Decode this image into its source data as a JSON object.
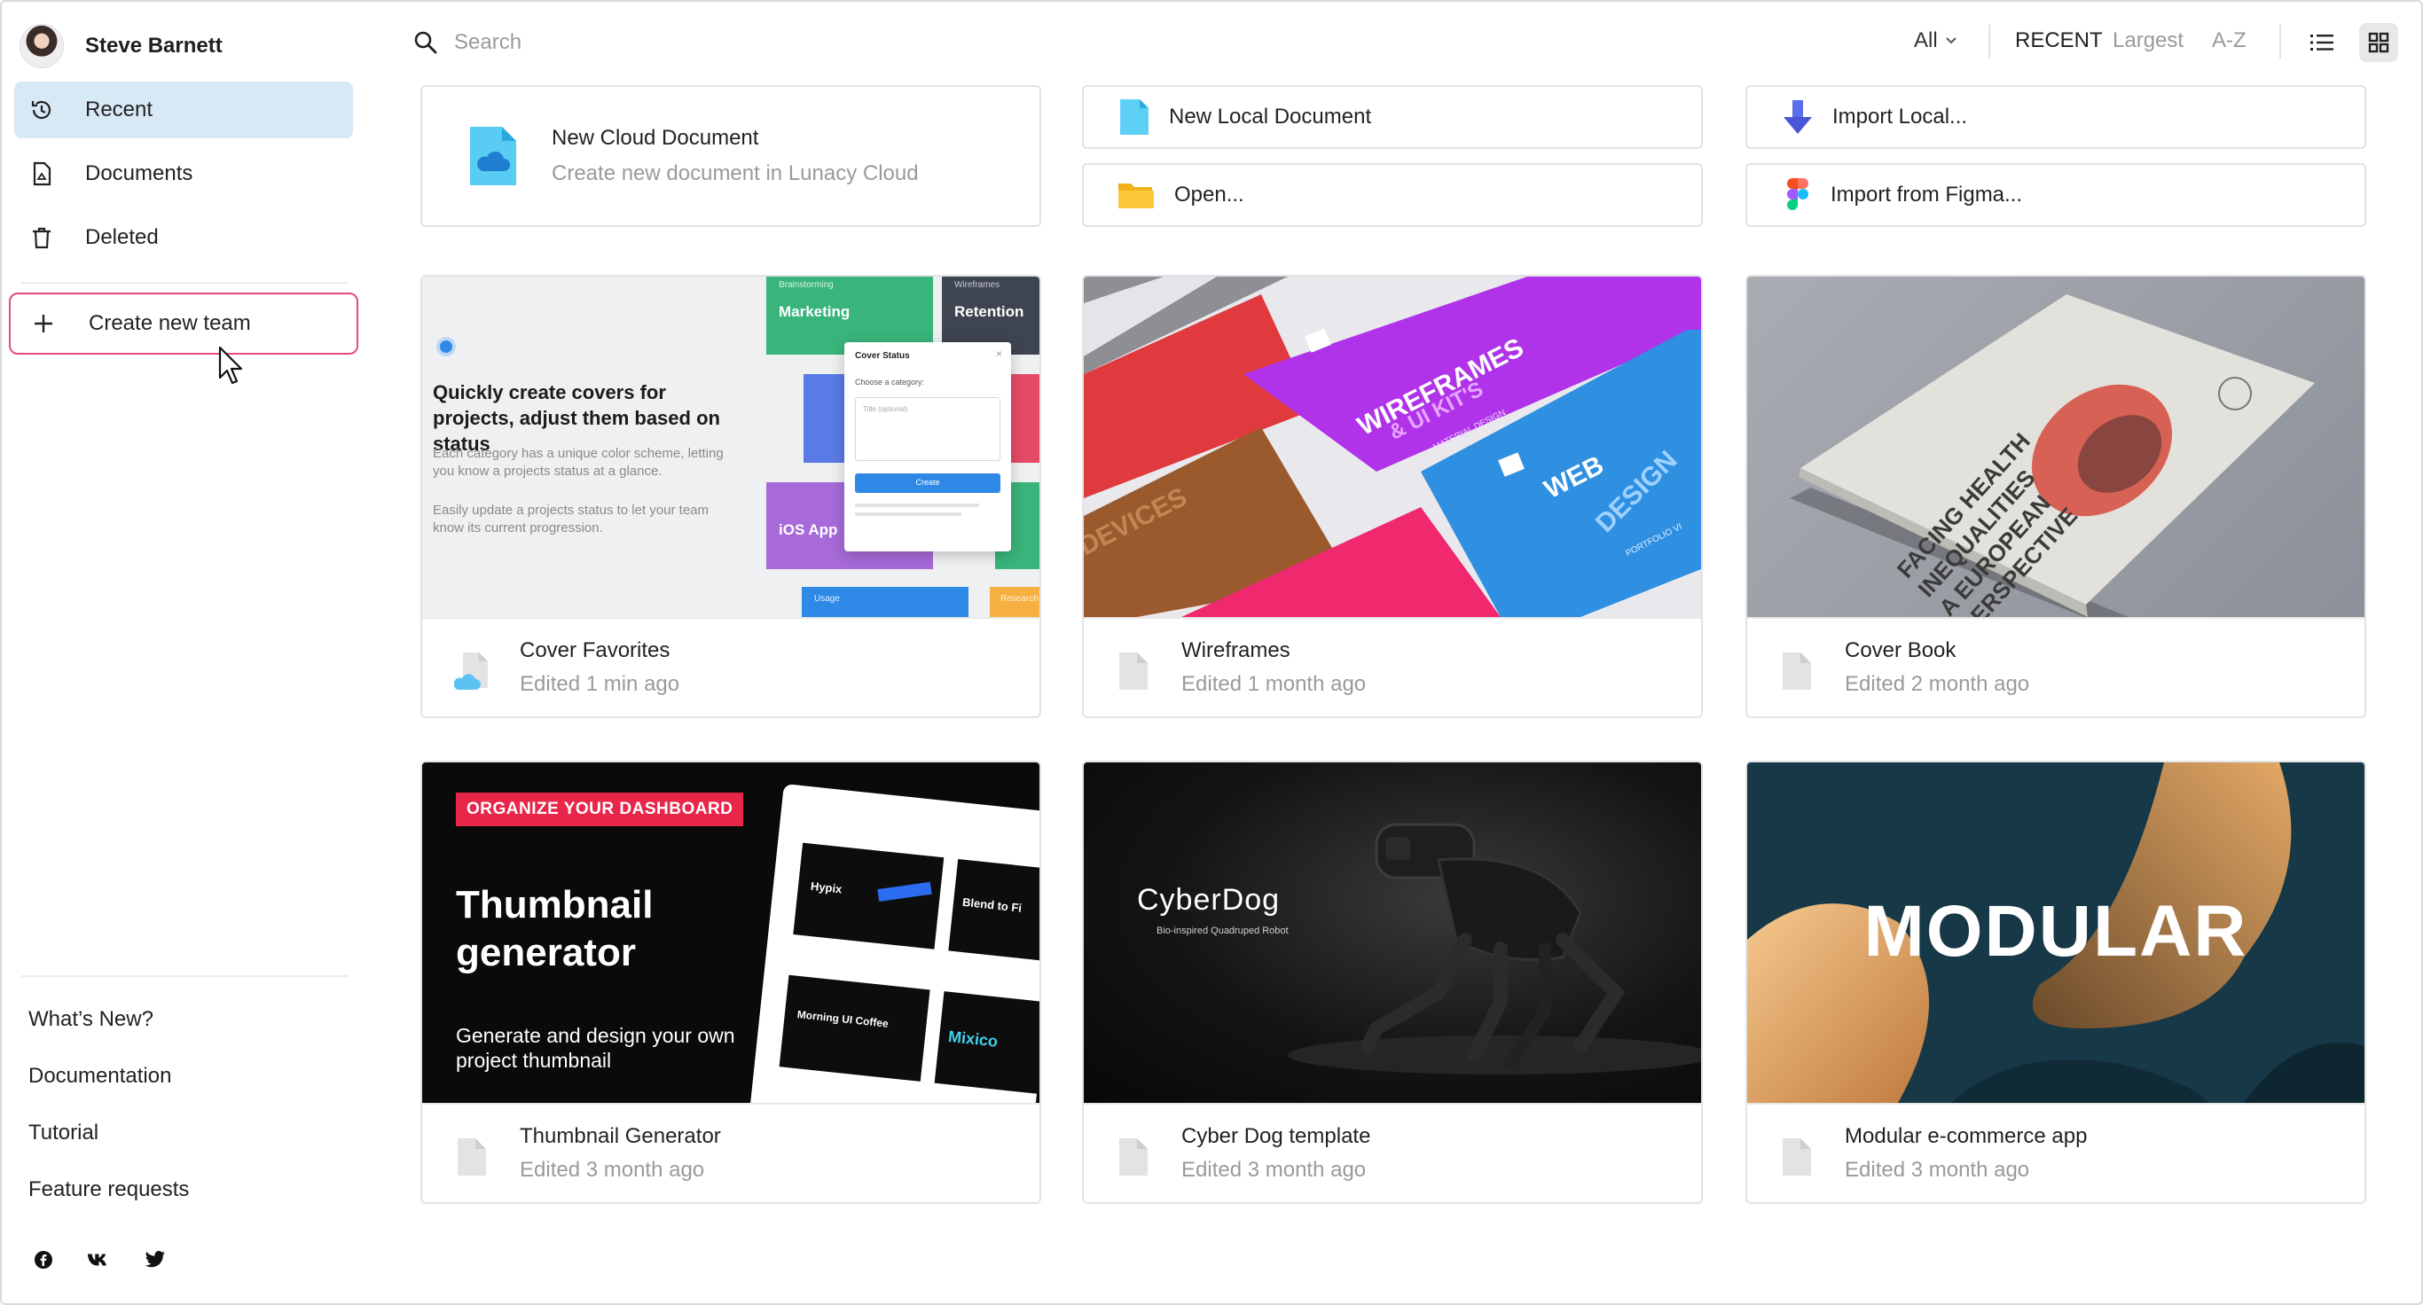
{
  "user": {
    "name": "Steve Barnett"
  },
  "nav": {
    "recent": "Recent",
    "documents": "Documents",
    "deleted": "Deleted",
    "create_team": "Create new team"
  },
  "footer": {
    "whats_new": "What’s New?",
    "documentation": "Documentation",
    "tutorial": "Tutorial",
    "feature_requests": "Feature requests"
  },
  "social": [
    "facebook-icon",
    "vk-icon",
    "twitter-icon"
  ],
  "search": {
    "placeholder": "Search"
  },
  "filters": {
    "all": "All",
    "recent": "RECENT",
    "largest": "Largest",
    "az": "A-Z"
  },
  "actions": {
    "new_cloud": {
      "title": "New Cloud Document",
      "subtitle": "Create new document in Lunacy Cloud"
    },
    "new_local": "New Local Document",
    "open": "Open...",
    "import_local": "Import Local...",
    "import_figma": "Import from Figma..."
  },
  "cards": [
    {
      "title": "Cover Favorites",
      "edited": "Edited 1 min ago",
      "cloud": true
    },
    {
      "title": "Wireframes",
      "edited": "Edited 1 month ago"
    },
    {
      "title": "Cover Book",
      "edited": "Edited 2 month ago"
    },
    {
      "title": "Thumbnail Generator",
      "edited": "Edited 3 month ago"
    },
    {
      "title": "Cyber Dog template",
      "edited": "Edited 3 month ago"
    },
    {
      "title": "Modular e-commerce app",
      "edited": "Edited 3 month ago"
    }
  ],
  "thumbs": {
    "cover": {
      "heading": "Quickly create covers for projects, adjust them based on status",
      "p1": "Each category has a unique color scheme, letting you know a projects status at a glance.",
      "p2": "Easily update a projects status to let your team know its current progression.",
      "marketing": "Marketing",
      "retention": "Retention",
      "ios": "iOS App",
      "brainstorming": "Brainstorming",
      "wireframes": "Wireframes",
      "dialog_title": "Cover Status",
      "dialog_label": "Choose a category:",
      "dialog_placeholder": "Title (optional)",
      "dialog_button": "Create",
      "usage": "Usage",
      "research": "Research"
    },
    "wireframes": {
      "a": "WIREFRAMES",
      "b": "& UI KIT'S",
      "c": "MATERIAL DESIGN",
      "d": "WEB",
      "e": "DESIGN",
      "f": "DEVICES",
      "g": "PORTFOLIO VI"
    },
    "book": {
      "line1": "FACING",
      "line2": "HEALTH",
      "line3": "INEQUALITIES",
      "line4": "A EUROPEAN",
      "line5": "PERSPECTIVE"
    },
    "thumbgen": {
      "badge": "ORGANIZE YOUR DASHBOARD",
      "title": "Thumbnail generator",
      "sub": "Generate and design your own project thumbnail",
      "t1": "Hypix",
      "t2": "Morning UI Coffee",
      "t3": "Blend to Fi",
      "t4": "Mixico"
    },
    "cyberdog": {
      "title": "CyberDog",
      "sub": "Bio-inspired Quadruped Robot"
    },
    "modular": {
      "title": "MODULAR"
    }
  },
  "colors": {
    "accent": "#e44d79",
    "active_bg": "#d8e9f6",
    "muted": "#9a9a9a"
  }
}
